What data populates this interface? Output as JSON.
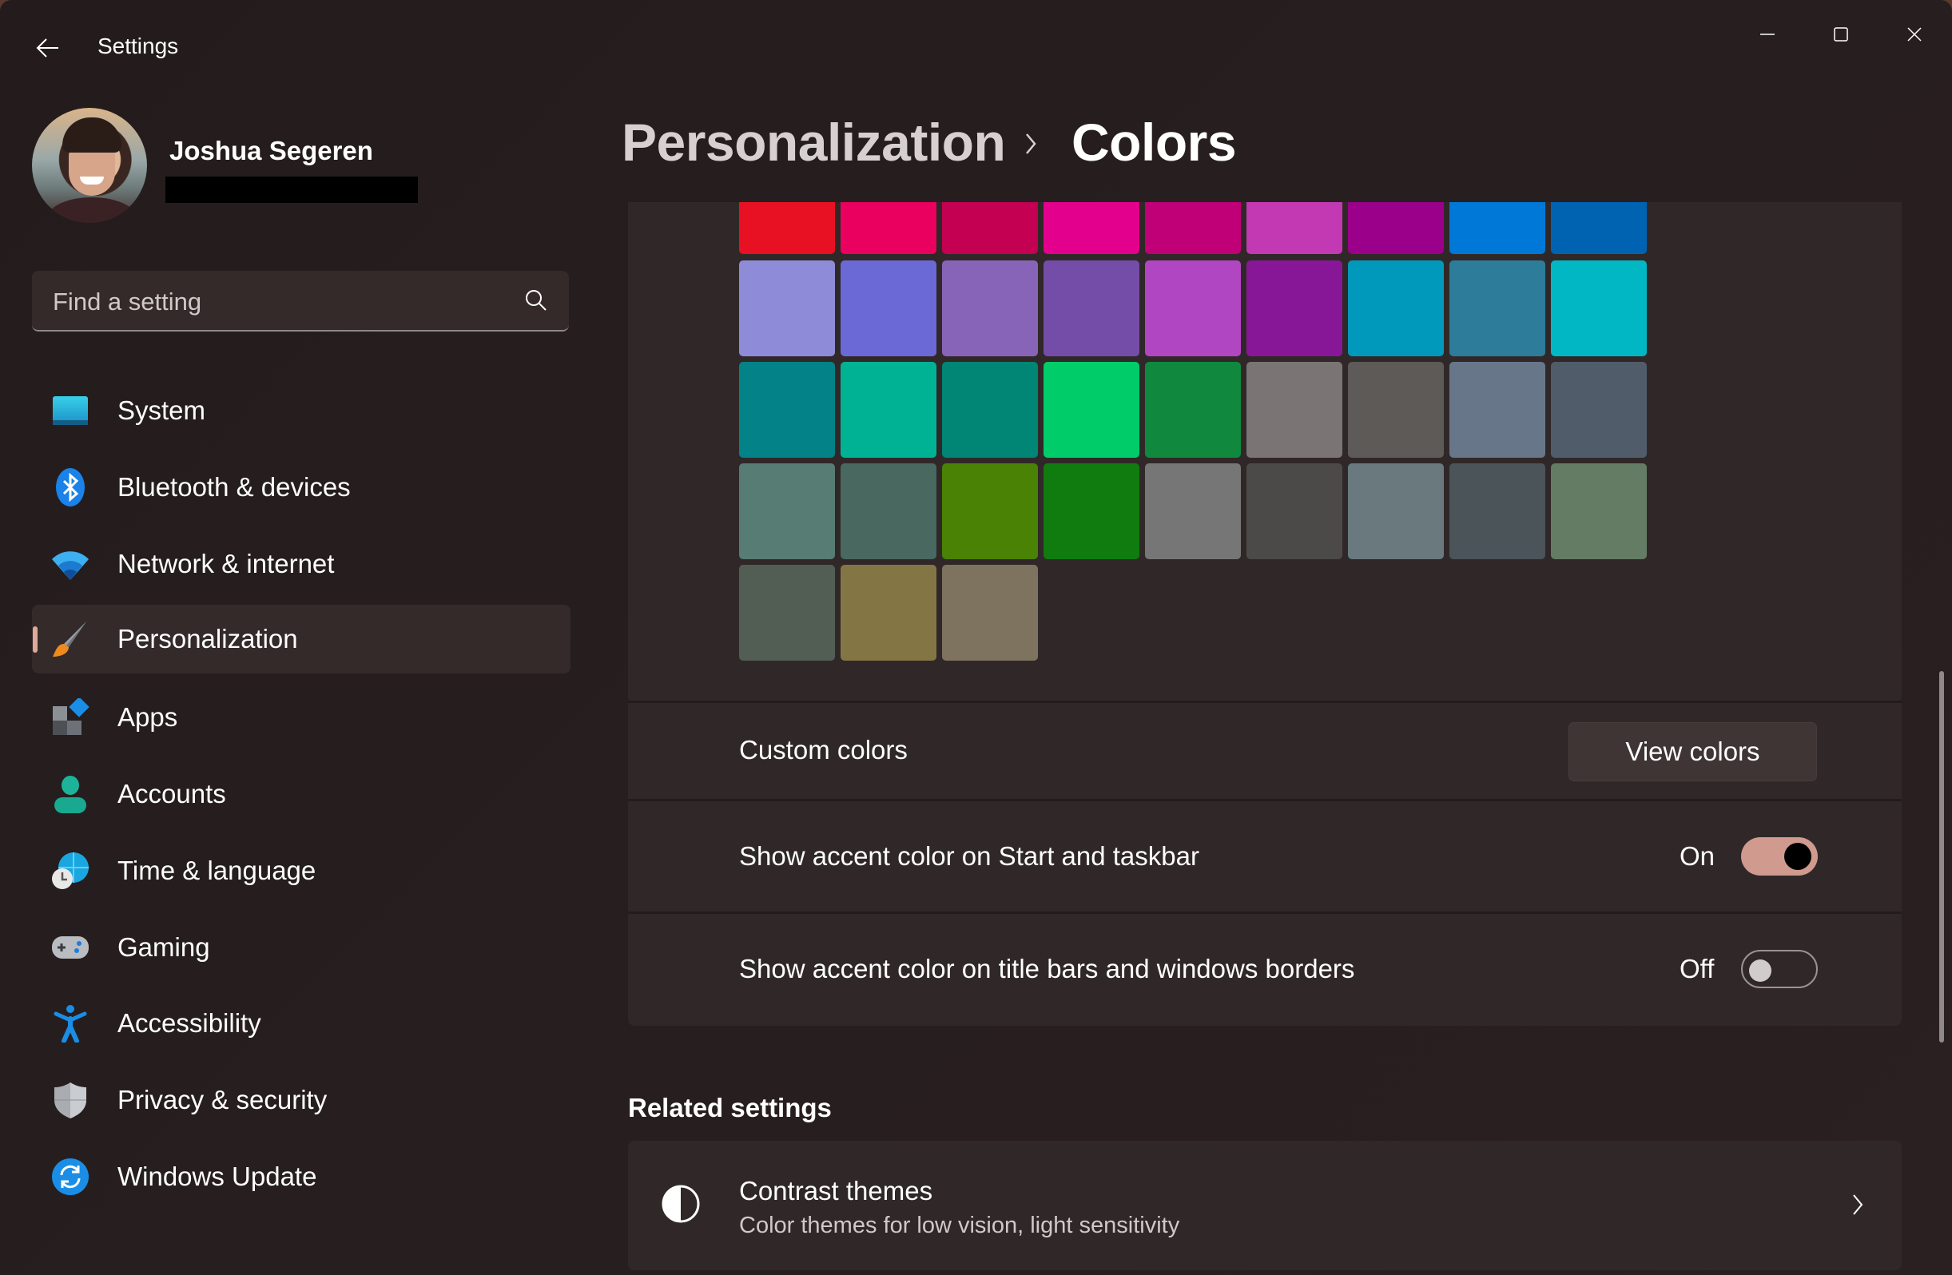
{
  "window": {
    "title": "Settings",
    "controls": {
      "minimize": "minimize",
      "maximize": "maximize",
      "close": "close"
    }
  },
  "profile": {
    "name": "Joshua Segeren",
    "email_redacted": true
  },
  "search": {
    "placeholder": "Find a setting",
    "value": ""
  },
  "sidebar": {
    "items": [
      {
        "label": "System",
        "icon": "system-icon",
        "active": false
      },
      {
        "label": "Bluetooth & devices",
        "icon": "bluetooth-icon",
        "active": false
      },
      {
        "label": "Network & internet",
        "icon": "wifi-icon",
        "active": false
      },
      {
        "label": "Personalization",
        "icon": "paintbrush-icon",
        "active": true
      },
      {
        "label": "Apps",
        "icon": "apps-icon",
        "active": false
      },
      {
        "label": "Accounts",
        "icon": "person-icon",
        "active": false
      },
      {
        "label": "Time & language",
        "icon": "globe-clock-icon",
        "active": false
      },
      {
        "label": "Gaming",
        "icon": "gamepad-icon",
        "active": false
      },
      {
        "label": "Accessibility",
        "icon": "accessibility-icon",
        "active": false
      },
      {
        "label": "Privacy & security",
        "icon": "shield-icon",
        "active": false
      },
      {
        "label": "Windows Update",
        "icon": "update-icon",
        "active": false
      }
    ]
  },
  "header": {
    "breadcrumb_parent": "Personalization",
    "breadcrumb_separator": "›",
    "breadcrumb_current": "Colors"
  },
  "accent_palette": {
    "rows": [
      [
        "#e81123",
        "#ea005e",
        "#c30052",
        "#e3008c",
        "#bf0077",
        "#c239b3",
        "#9a0089",
        "#0078d7",
        "#0063b1"
      ],
      [
        "#8e8cd8",
        "#6b69d6",
        "#8764b8",
        "#744da9",
        "#b146c2",
        "#881798",
        "#0099bc",
        "#2d7d9a",
        "#00b7c3"
      ],
      [
        "#038387",
        "#00b294",
        "#018574",
        "#00cc6a",
        "#10893e",
        "#7a7574",
        "#5d5a58",
        "#68768a",
        "#515c6b"
      ],
      [
        "#567c73",
        "#486860",
        "#498205",
        "#107c10",
        "#767676",
        "#4c4a48",
        "#69797e",
        "#4a5459",
        "#647c64"
      ],
      [
        "#525e54",
        "#847545",
        "#7e735f"
      ]
    ]
  },
  "settings": {
    "custom_colors": {
      "label": "Custom colors",
      "button": "View colors"
    },
    "accent_start_taskbar": {
      "label": "Show accent color on Start and taskbar",
      "state_label": "On",
      "on": true
    },
    "accent_title_bars": {
      "label": "Show accent color on title bars and windows borders",
      "state_label": "Off",
      "on": false
    }
  },
  "related": {
    "heading": "Related settings",
    "items": [
      {
        "title": "Contrast themes",
        "subtitle": "Color themes for low vision, light sensitivity",
        "icon": "contrast-icon"
      }
    ]
  },
  "colors": {
    "accent": "#d09a8e",
    "toggle_on": "#d09a8e",
    "background": "#241c1c",
    "card": "#302828"
  }
}
